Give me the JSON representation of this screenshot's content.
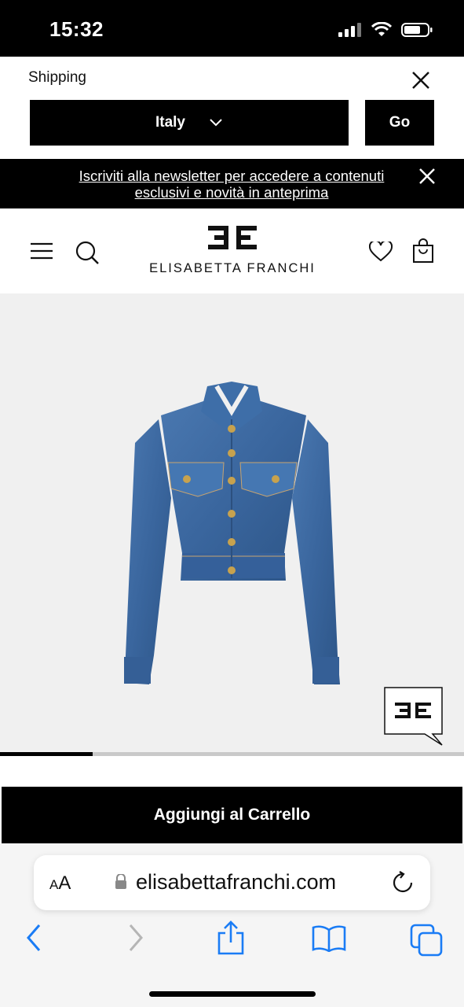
{
  "status": {
    "time": "15:32"
  },
  "shipping": {
    "label": "Shipping",
    "country": "Italy",
    "go_label": "Go"
  },
  "newsletter": {
    "text": "Iscriviti alla newsletter per accedere a contenuti esclusivi e novità in anteprima"
  },
  "header": {
    "brand": "ELISABETTA FRANCHI"
  },
  "product": {
    "cta_label": "Aggiungi al Carrello",
    "carousel_progress": 0.2
  },
  "browser": {
    "aa_small": "A",
    "aa_large": "A",
    "url": "elisabettafranchi.com"
  },
  "colors": {
    "primary": "#000000",
    "image_bg": "#f0f0f0",
    "ios_blue": "#1a7cf5",
    "denim": "#3d6aa3"
  }
}
